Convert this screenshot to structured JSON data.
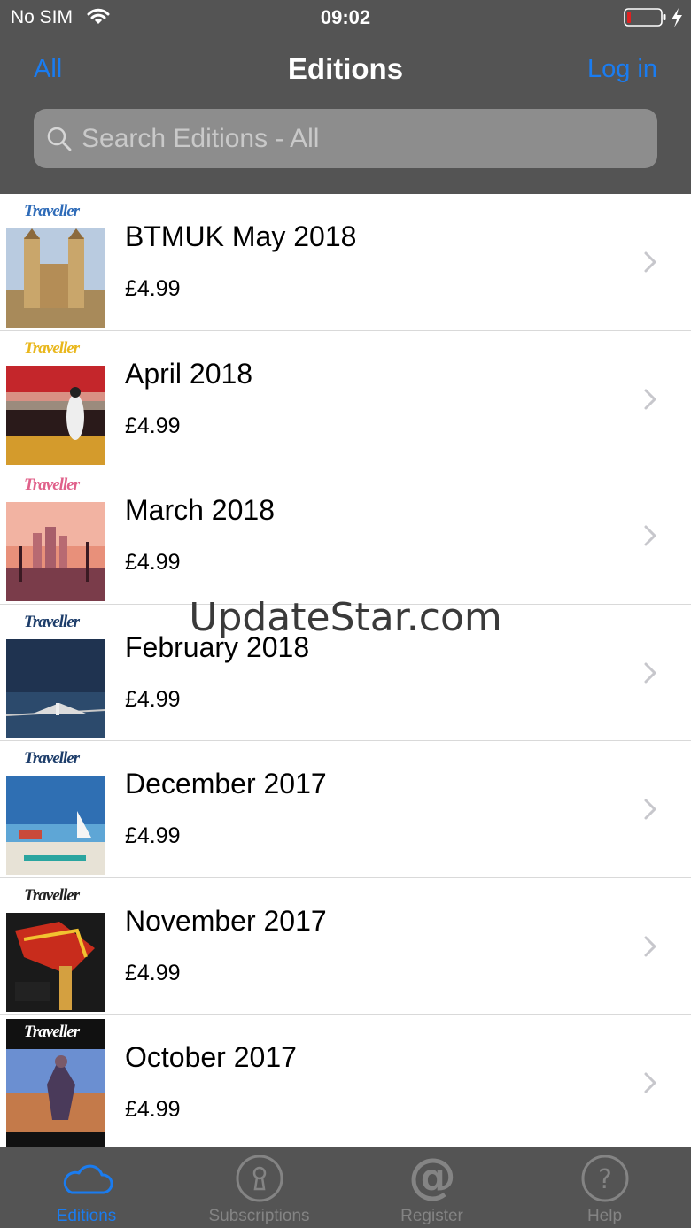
{
  "status_bar": {
    "carrier": "No SIM",
    "time": "09:02"
  },
  "nav": {
    "left": "All",
    "title": "Editions",
    "right": "Log in"
  },
  "search": {
    "placeholder": "Search Editions - All"
  },
  "editions": [
    {
      "title": "BTMUK May 2018",
      "price": "£4.99",
      "logo": "Traveller",
      "logo_color": "#2e6bb8"
    },
    {
      "title": "April 2018",
      "price": "£4.99",
      "logo": "Traveller",
      "logo_color": "#e9b71c"
    },
    {
      "title": "March 2018",
      "price": "£4.99",
      "logo": "Traveller",
      "logo_color": "#e0608a"
    },
    {
      "title": "February 2018",
      "price": "£4.99",
      "logo": "Traveller",
      "logo_color": "#1d3d6a"
    },
    {
      "title": "December 2017",
      "price": "£4.99",
      "logo": "Traveller",
      "logo_color": "#1d3d6a"
    },
    {
      "title": "November 2017",
      "price": "£4.99",
      "logo": "Traveller",
      "logo_color": "#222222"
    },
    {
      "title": "October 2017",
      "price": "£4.99",
      "logo": "Traveller",
      "logo_color": "#ffffff"
    }
  ],
  "watermark": "UpdateStar.com",
  "tabs": [
    {
      "label": "Editions",
      "icon": "cloud-icon",
      "active": true
    },
    {
      "label": "Subscriptions",
      "icon": "keyhole-icon",
      "active": false
    },
    {
      "label": "Register",
      "icon": "at-sign-icon",
      "active": false
    },
    {
      "label": "Help",
      "icon": "question-icon",
      "active": false
    }
  ],
  "colors": {
    "bar": "#545454",
    "accent": "#1a7cf0",
    "inactive_tab": "#848484",
    "battery_low": "#e02020"
  }
}
